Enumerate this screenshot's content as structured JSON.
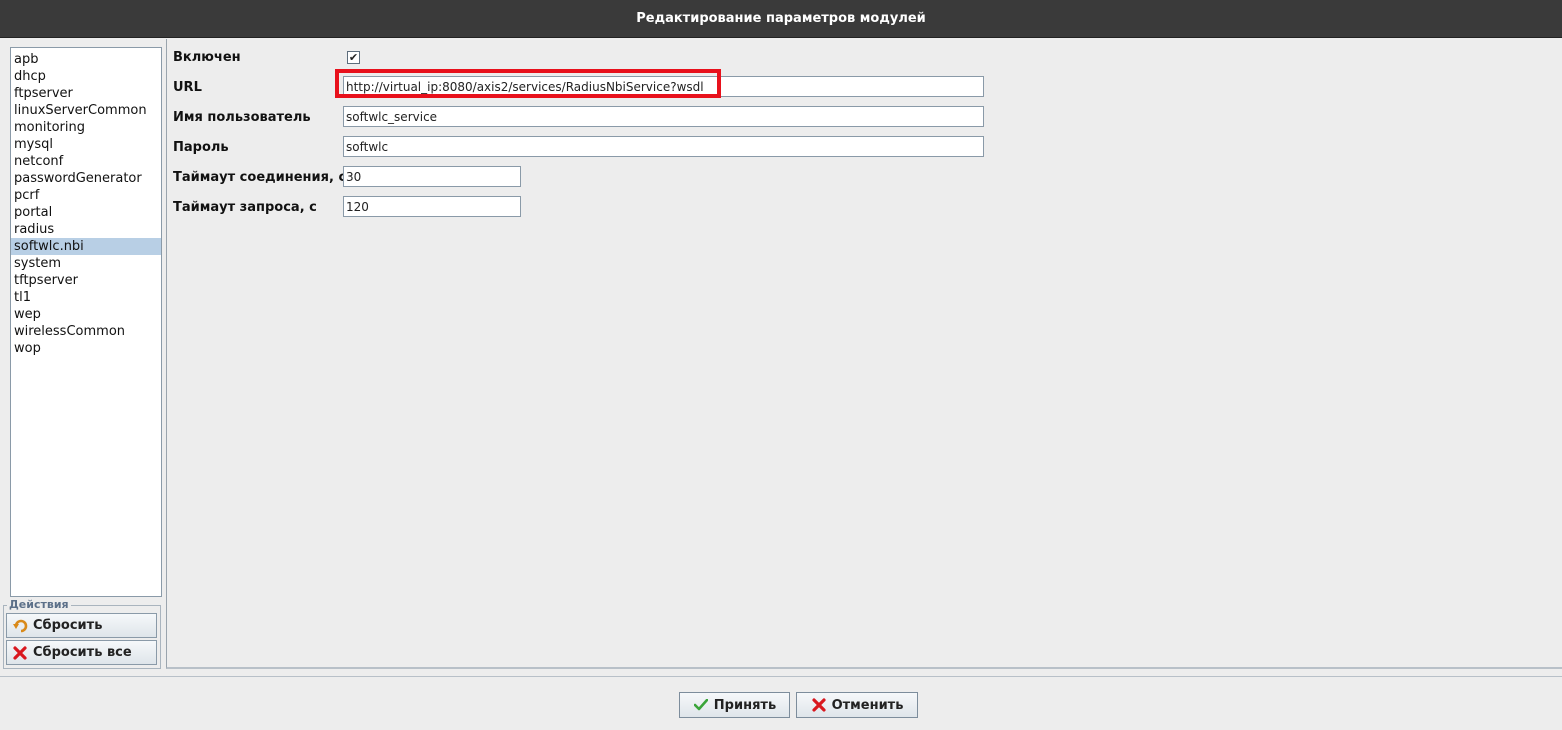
{
  "window": {
    "title": "Редактирование параметров модулей"
  },
  "modules": [
    "apb",
    "dhcp",
    "ftpserver",
    "linuxServerCommon",
    "monitoring",
    "mysql",
    "netconf",
    "passwordGenerator",
    "pcrf",
    "portal",
    "radius",
    "softwlc.nbi",
    "system",
    "tftpserver",
    "tl1",
    "wep",
    "wirelessCommon",
    "wop"
  ],
  "selected_module": "softwlc.nbi",
  "actions": {
    "legend": "Действия",
    "reset_label": "Сбросить",
    "reset_all_label": "Сбросить все"
  },
  "form": {
    "enabled": {
      "label": "Включен",
      "checked": true,
      "mark": "✔"
    },
    "url": {
      "label": "URL",
      "value": "http://virtual_ip:8080/axis2/services/RadiusNbiService?wsdl"
    },
    "username": {
      "label": "Имя пользователь",
      "value": "softwlc_service"
    },
    "password": {
      "label": "Пароль",
      "value": "softwlc"
    },
    "connect_timeout": {
      "label": "Таймаут соединения, с",
      "value": "30"
    },
    "request_timeout": {
      "label": "Таймаут запроса, с",
      "value": "120"
    }
  },
  "buttons": {
    "accept_label": "Принять",
    "cancel_label": "Отменить"
  },
  "colors": {
    "highlight": "#e8111c",
    "selection": "#b8cfe5",
    "titlebar": "#3a3a3a"
  }
}
